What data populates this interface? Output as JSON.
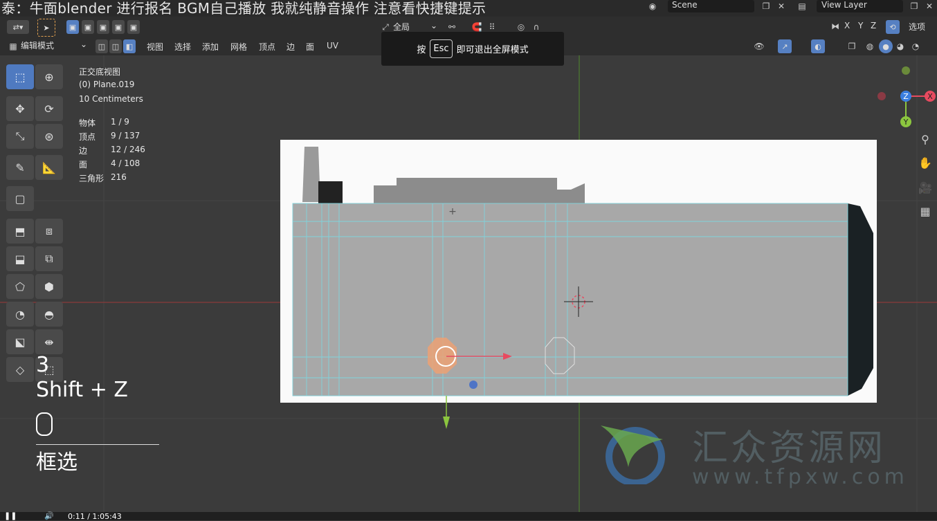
{
  "title_overlay": "泰：牛面blender 进行报名 BGM自己播放 我就纯静音操作 注意看快捷键提示",
  "header": {
    "scene_label": "Scene",
    "view_layer_label": "View Layer"
  },
  "toolbar": {
    "transform_orientation": "全局",
    "axes": [
      "X",
      "Y",
      "Z"
    ],
    "options_label": "选项"
  },
  "mode_bar": {
    "mode": "编辑模式",
    "menus": [
      "视图",
      "选择",
      "添加",
      "网格",
      "顶点",
      "边",
      "面",
      "UV"
    ]
  },
  "fullscreen_tip": {
    "prefix": "按",
    "key": "Esc",
    "suffix": "即可退出全屏模式"
  },
  "viewport_info": {
    "view_name": "正交底视图",
    "object_name": "(0) Plane.019",
    "scale": "10 Centimeters",
    "stats": [
      {
        "label": "物体",
        "value": "1 / 9"
      },
      {
        "label": "顶点",
        "value": "9 / 137"
      },
      {
        "label": "边",
        "value": "12 / 246"
      },
      {
        "label": "面",
        "value": "4 / 108"
      },
      {
        "label": "三角形",
        "value": "216"
      }
    ]
  },
  "gizmo": {
    "x": "X",
    "y": "Y",
    "z": "Z"
  },
  "key_overlay": {
    "number": "3",
    "shortcut": "Shift + Z",
    "action": "框选"
  },
  "watermark": {
    "text": "汇众资源网",
    "url": "www.tfpxw.com"
  },
  "playback": {
    "time": "0:11 / 1:05:43"
  },
  "colors": {
    "accent": "#5680c2",
    "x_axis": "#e84a5f",
    "y_axis": "#8cc63f",
    "z_axis": "#3a7ee0"
  }
}
